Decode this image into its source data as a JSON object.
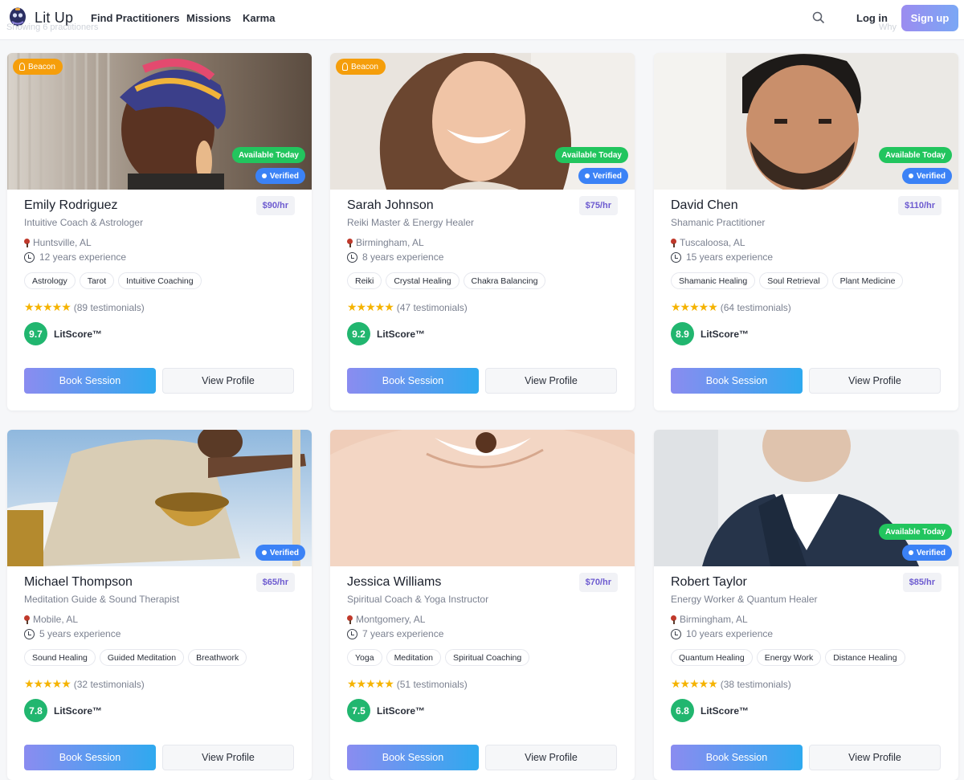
{
  "header": {
    "brand": "Lit Up",
    "nav": [
      "Find Practitioners",
      "Missions",
      "Karma"
    ],
    "overlay_left": "Showing 6 practitioners",
    "overlay_right": "Why",
    "login": "Log in",
    "signup": "Sign up"
  },
  "common": {
    "book": "Book Session",
    "view": "View Profile",
    "litscore": "LitScore™",
    "beacon": "Beacon",
    "available": "Available Today",
    "verified": "Verified"
  },
  "practitioners": [
    {
      "name": "Emily Rodriguez",
      "price": "$90/hr",
      "title": "Intuitive Coach & Astrologer",
      "location": "Huntsville, AL",
      "experience": "12 years experience",
      "tags": [
        "Astrology",
        "Tarot",
        "Intuitive Coaching"
      ],
      "testimonials": "(89 testimonials)",
      "score": "9.7",
      "rating": 5
    },
    {
      "name": "Sarah Johnson",
      "price": "$75/hr",
      "title": "Reiki Master & Energy Healer",
      "location": "Birmingham, AL",
      "experience": "8 years experience",
      "tags": [
        "Reiki",
        "Crystal Healing",
        "Chakra Balancing"
      ],
      "testimonials": "(47 testimonials)",
      "score": "9.2",
      "rating": 5
    },
    {
      "name": "David Chen",
      "price": "$110/hr",
      "title": "Shamanic Practitioner",
      "location": "Tuscaloosa, AL",
      "experience": "15 years experience",
      "tags": [
        "Shamanic Healing",
        "Soul Retrieval",
        "Plant Medicine"
      ],
      "testimonials": "(64 testimonials)",
      "score": "8.9",
      "rating": 5
    },
    {
      "name": "Michael Thompson",
      "price": "$65/hr",
      "title": "Meditation Guide & Sound Therapist",
      "location": "Mobile, AL",
      "experience": "5 years experience",
      "tags": [
        "Sound Healing",
        "Guided Meditation",
        "Breathwork"
      ],
      "testimonials": "(32 testimonials)",
      "score": "7.8",
      "rating": 5
    },
    {
      "name": "Jessica Williams",
      "price": "$70/hr",
      "title": "Spiritual Coach & Yoga Instructor",
      "location": "Montgomery, AL",
      "experience": "7 years experience",
      "tags": [
        "Yoga",
        "Meditation",
        "Spiritual Coaching"
      ],
      "testimonials": "(51 testimonials)",
      "score": "7.5",
      "rating": 5
    },
    {
      "name": "Robert Taylor",
      "price": "$85/hr",
      "title": "Energy Worker & Quantum Healer",
      "location": "Birmingham, AL",
      "experience": "10 years experience",
      "tags": [
        "Quantum Healing",
        "Energy Work",
        "Distance Healing"
      ],
      "testimonials": "(38 testimonials)",
      "score": "6.8",
      "rating": 5
    }
  ]
}
